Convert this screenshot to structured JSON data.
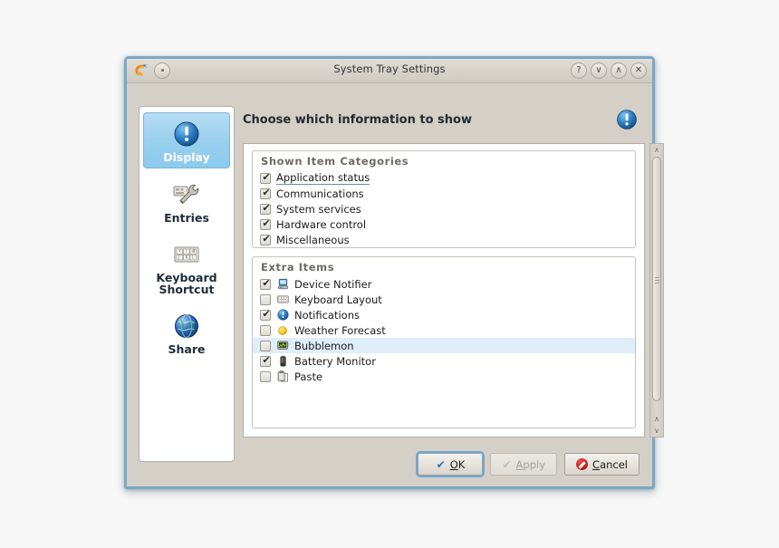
{
  "window": {
    "title": "System Tray Settings",
    "app_icon": "kde-plasma-icon",
    "titlebar_buttons": [
      {
        "name": "pin-button",
        "glyph": ""
      },
      {
        "name": "help-button",
        "glyph": "?"
      },
      {
        "name": "shade-button",
        "glyph": "∨"
      },
      {
        "name": "maximize-button",
        "glyph": "∧"
      },
      {
        "name": "close-button",
        "glyph": "✕"
      }
    ]
  },
  "sidebar": {
    "items": [
      {
        "label": "Display",
        "icon": "info-circle-icon",
        "selected": true
      },
      {
        "label": "Entries",
        "icon": "wrench-icon",
        "selected": false
      },
      {
        "label": "Keyboard Shortcut",
        "icon": "keyboard-icon",
        "selected": false
      },
      {
        "label": "Share",
        "icon": "globe-icon",
        "selected": false
      }
    ]
  },
  "header": {
    "title": "Choose which information to show",
    "icon": "info-circle-icon"
  },
  "groups": [
    {
      "id": "shown-item-categories",
      "title": "Shown Item Categories",
      "rows": [
        {
          "label": "Application status",
          "checked": true,
          "icon": null,
          "highlight": false,
          "focused": true
        },
        {
          "label": "Communications",
          "checked": true,
          "icon": null,
          "highlight": false,
          "focused": false
        },
        {
          "label": "System services",
          "checked": true,
          "icon": null,
          "highlight": false,
          "focused": false
        },
        {
          "label": "Hardware control",
          "checked": true,
          "icon": null,
          "highlight": false,
          "focused": false
        },
        {
          "label": "Miscellaneous",
          "checked": true,
          "icon": null,
          "highlight": false,
          "focused": false
        }
      ]
    },
    {
      "id": "extra-items",
      "title": "Extra Items",
      "rows": [
        {
          "label": "Device Notifier",
          "checked": true,
          "icon": "device-notifier-icon",
          "highlight": false,
          "focused": false
        },
        {
          "label": "Keyboard Layout",
          "checked": false,
          "icon": "keyboard-icon",
          "highlight": false,
          "focused": false
        },
        {
          "label": "Notifications",
          "checked": true,
          "icon": "info-circle-icon",
          "highlight": false,
          "focused": false
        },
        {
          "label": "Weather Forecast",
          "checked": false,
          "icon": "sun-icon",
          "highlight": false,
          "focused": false
        },
        {
          "label": "Bubblemon",
          "checked": false,
          "icon": "monitor-icon",
          "highlight": true,
          "focused": false
        },
        {
          "label": "Battery Monitor",
          "checked": true,
          "icon": "battery-icon",
          "highlight": false,
          "focused": false
        },
        {
          "label": "Paste",
          "checked": false,
          "icon": "clipboard-icon",
          "highlight": false,
          "focused": false
        }
      ]
    }
  ],
  "scrollbar": {
    "up_glyph": "∧",
    "down_glyph": "∨"
  },
  "buttons": [
    {
      "name": "ok-button",
      "label": "OK",
      "accel": "O",
      "icon": "checkmark-icon",
      "state": "default"
    },
    {
      "name": "apply-button",
      "label": "Apply",
      "accel": "A",
      "icon": "checkmark-icon",
      "state": "disabled"
    },
    {
      "name": "cancel-button",
      "label": "Cancel",
      "accel": "C",
      "icon": "stop-icon",
      "state": "normal"
    }
  ],
  "colors": {
    "window_frame": "#7ba7c4",
    "window_bg": "#d4d0c8",
    "selection_blue": "#9ad0ee",
    "row_highlight": "#dfeef9",
    "accent_blue": "#2f6ea8",
    "cancel_red": "#b91712"
  }
}
